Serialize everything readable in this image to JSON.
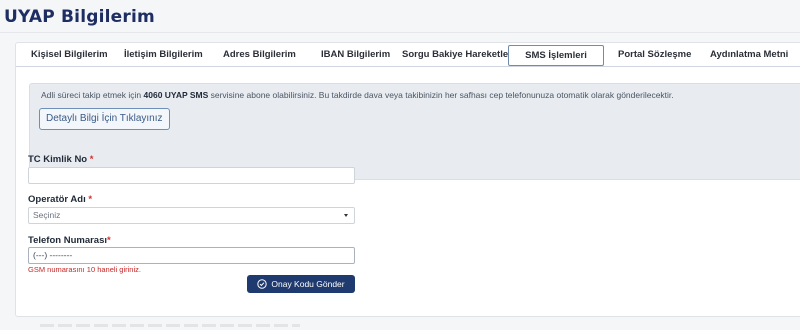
{
  "page": {
    "title": "UYAP Bilgilerim"
  },
  "tabs": [
    {
      "label": "Kişisel Bilgilerim"
    },
    {
      "label": "İletişim Bilgilerim"
    },
    {
      "label": "Adres Bilgilerim"
    },
    {
      "label": "IBAN Bilgilerim"
    },
    {
      "label": "Sorgu Bakiye Hareketleri"
    },
    {
      "label": "SMS İşlemleri",
      "active": true
    },
    {
      "label": "Portal Sözleşme"
    },
    {
      "label": "Aydınlatma Metni"
    }
  ],
  "info": {
    "text_before": "Adli süreci takip etmek için ",
    "text_bold": "4060 UYAP SMS",
    "text_after": " servisine abone olabilirsiniz. Bu takdirde dava veya takibinizin her safhası cep telefonunuza otomatik olarak gönderilecektir.",
    "detail_button": "Detaylı Bilgi İçin Tıklayınız"
  },
  "form": {
    "tc_label": "TC Kimlik No",
    "tc_required": "*",
    "tc_value": "",
    "operator_label": "Operatör Adı",
    "operator_required": "*",
    "operator_selected": "Seçiniz",
    "phone_label": "Telefon Numarası",
    "phone_required": "*",
    "phone_value": "(---) --------",
    "phone_error": "GSM numarasını 10 haneli giriniz.",
    "submit_label": "Onay Kodu Gönder"
  },
  "colors": {
    "title": "#1e2e62",
    "submit_bg": "#1f3a6e",
    "required": "#d32f2f",
    "error": "#c62828",
    "info_bg": "#e8ecf1"
  },
  "icons": {
    "submit": "check-circle-icon",
    "select": "caret-down-icon"
  }
}
